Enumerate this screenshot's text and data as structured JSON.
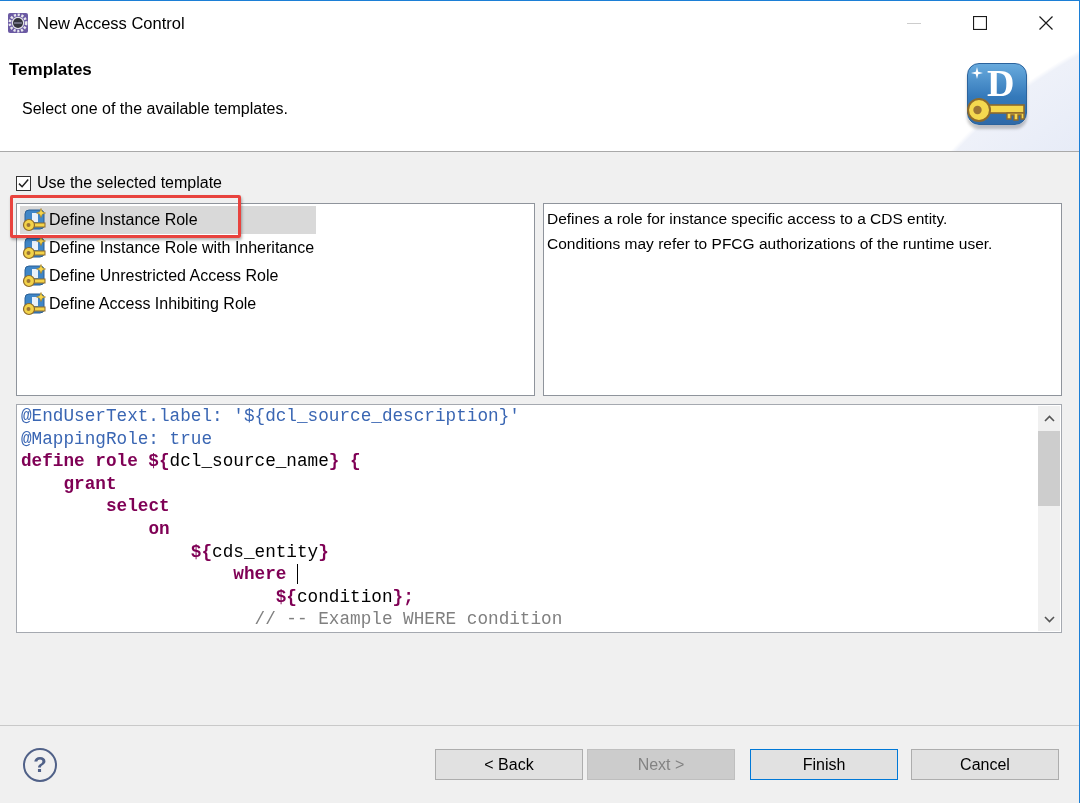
{
  "window": {
    "title": "New Access Control",
    "controls": [
      {
        "kind": "minimize",
        "disabled": true
      },
      {
        "kind": "maximize",
        "disabled": false
      },
      {
        "kind": "close",
        "disabled": false
      }
    ]
  },
  "header": {
    "title": "Templates",
    "description": "Select one of the available templates.",
    "logo_letter": "D"
  },
  "use_template": {
    "label": "Use the selected template",
    "checked": true
  },
  "templates": [
    {
      "label": "Define Instance Role",
      "selected": true,
      "callout": true
    },
    {
      "label": "Define Instance Role with Inheritance",
      "selected": false,
      "callout": false
    },
    {
      "label": "Define Unrestricted Access Role",
      "selected": false,
      "callout": false
    },
    {
      "label": "Define Access Inhibiting Role",
      "selected": false,
      "callout": false
    }
  ],
  "template_description": "Defines a role for instance specific access to a CDS entity.\nConditions may refer to PFCG authorizations of the runtime user.",
  "code": [
    {
      "caret": false,
      "tokens": [
        {
          "text": "@EndUserText.label: '${dcl_source_description}'",
          "kind": "annotation"
        }
      ]
    },
    {
      "caret": false,
      "tokens": [
        {
          "text": "@MappingRole: true",
          "kind": "annotation"
        }
      ]
    },
    {
      "caret": false,
      "tokens": [
        {
          "text": "define role ${",
          "kind": "keyword"
        },
        {
          "text": "dcl_source_name",
          "kind": "plain"
        },
        {
          "text": "} {",
          "kind": "keyword"
        }
      ]
    },
    {
      "caret": false,
      "tokens": [
        {
          "text": "    grant",
          "kind": "keyword"
        }
      ]
    },
    {
      "caret": false,
      "tokens": [
        {
          "text": "        select",
          "kind": "keyword"
        }
      ]
    },
    {
      "caret": false,
      "tokens": [
        {
          "text": "            on",
          "kind": "keyword"
        }
      ]
    },
    {
      "caret": false,
      "tokens": [
        {
          "text": "                ${",
          "kind": "keyword"
        },
        {
          "text": "cds_entity",
          "kind": "plain"
        },
        {
          "text": "}",
          "kind": "keyword"
        }
      ]
    },
    {
      "caret": true,
      "tokens": [
        {
          "text": "                    where ",
          "kind": "keyword"
        }
      ]
    },
    {
      "caret": false,
      "tokens": [
        {
          "text": "                        ${",
          "kind": "keyword"
        },
        {
          "text": "condition",
          "kind": "plain"
        },
        {
          "text": "};",
          "kind": "keyword"
        }
      ]
    },
    {
      "caret": false,
      "tokens": [
        {
          "text": "                      // -- Example WHERE condition",
          "kind": "comment"
        }
      ]
    }
  ],
  "help": {
    "glyph": "?"
  },
  "buttons": [
    {
      "label": "< Back",
      "disabled": false,
      "default": false
    },
    {
      "label": "Next >",
      "disabled": true,
      "default": false
    },
    {
      "label": "Finish",
      "disabled": false,
      "default": true
    },
    {
      "label": "Cancel",
      "disabled": false,
      "default": false
    }
  ]
}
